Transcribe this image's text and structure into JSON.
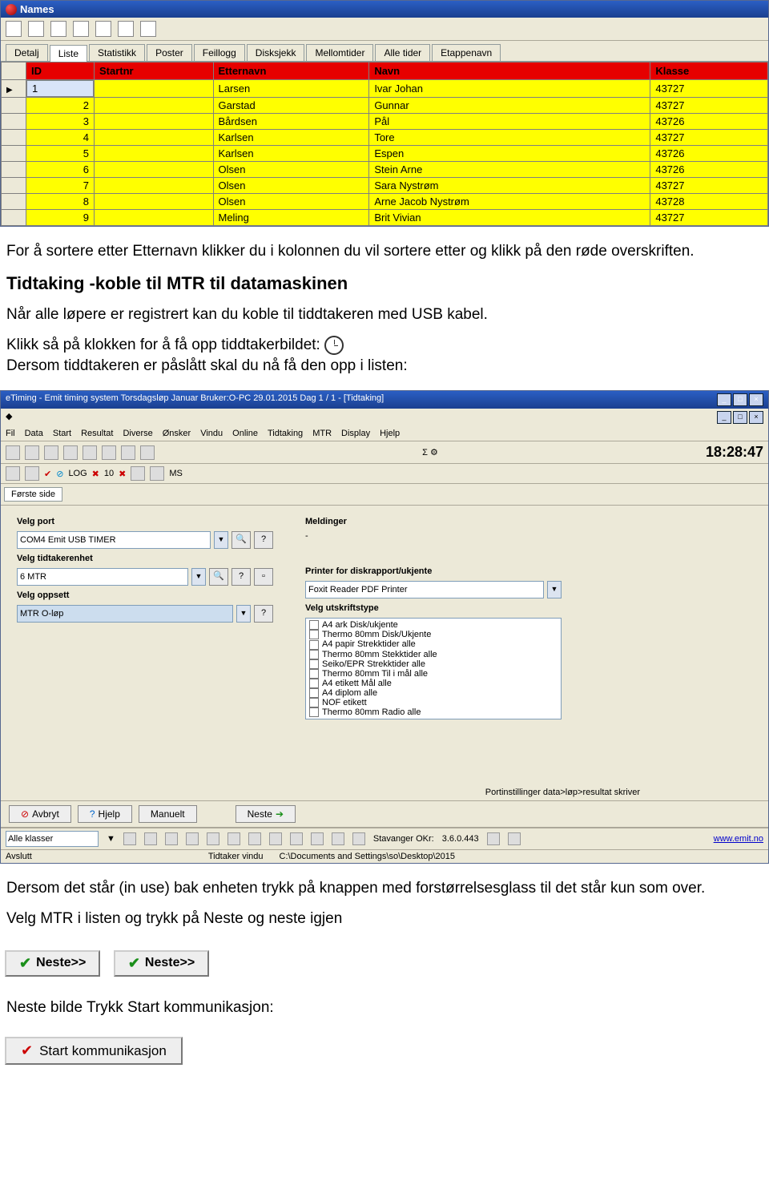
{
  "names_window": {
    "title": "Names",
    "tabs": [
      "Detalj",
      "Liste",
      "Statistikk",
      "Poster",
      "Feillogg",
      "Disksjekk",
      "Mellomtider",
      "Alle tider",
      "Etappenavn"
    ],
    "active_tab": "Liste",
    "columns": [
      "ID",
      "Startnr",
      "Etternavn",
      "Navn",
      "Klasse"
    ],
    "rows": [
      {
        "id": "1",
        "startnr": "",
        "etternavn": "Larsen",
        "navn": "Ivar Johan",
        "klasse": "43727",
        "current": true
      },
      {
        "id": "2",
        "startnr": "",
        "etternavn": "Garstad",
        "navn": "Gunnar",
        "klasse": "43727"
      },
      {
        "id": "3",
        "startnr": "",
        "etternavn": "Bårdsen",
        "navn": "Pål",
        "klasse": "43726"
      },
      {
        "id": "4",
        "startnr": "",
        "etternavn": "Karlsen",
        "navn": "Tore",
        "klasse": "43727"
      },
      {
        "id": "5",
        "startnr": "",
        "etternavn": "Karlsen",
        "navn": "Espen",
        "klasse": "43726"
      },
      {
        "id": "6",
        "startnr": "",
        "etternavn": "Olsen",
        "navn": "Stein Arne",
        "klasse": "43726"
      },
      {
        "id": "7",
        "startnr": "",
        "etternavn": "Olsen",
        "navn": "Sara Nystrøm",
        "klasse": "43727"
      },
      {
        "id": "8",
        "startnr": "",
        "etternavn": "Olsen",
        "navn": "Arne Jacob Nystrøm",
        "klasse": "43728"
      },
      {
        "id": "9",
        "startnr": "",
        "etternavn": "Meling",
        "navn": "Brit Vivian",
        "klasse": "43727"
      }
    ]
  },
  "text": {
    "p1": "For å sortere etter Etternavn klikker du i kolonnen du vil sortere etter og klikk på den røde overskriften.",
    "h1": "Tidtaking -koble til MTR til datamaskinen",
    "p2": "Når alle løpere er registrert kan du koble til tiddtakeren med USB kabel.",
    "p3a": "Klikk så på klokken for å få opp tiddtakerbildet:",
    "p3b": "Dersom tiddtakeren er påslått skal du nå få den opp i listen:",
    "p4": "Dersom det står (in use) bak enheten trykk på knappen med forstørrelsesglass til det står kun som over.",
    "p5": "Velg MTR i listen og trykk på Neste og neste igjen",
    "p6": "Neste bilde Trykk Start kommunikasjon:"
  },
  "app2": {
    "title": "eTiming - Emit timing system  Torsdagsløp Januar  Bruker:O-PC  29.01.2015  Dag 1 / 1 - [Tidtaking]",
    "menus": [
      "Fil",
      "Data",
      "Start",
      "Resultat",
      "Diverse",
      "Ønsker",
      "Vindu",
      "Online",
      "Tidtaking",
      "MTR",
      "Display",
      "Hjelp"
    ],
    "time": "18:28:47",
    "toolbar_text": [
      "LOG",
      "10",
      "MS"
    ],
    "side_tab": "Første side",
    "left": {
      "port_label": "Velg port",
      "port_value": "COM4 Emit USB TIMER",
      "enhet_label": "Velg tidtakerenhet",
      "enhet_value": "6 MTR",
      "oppsett_label": "Velg oppsett",
      "oppsett_value": "MTR O-løp"
    },
    "right": {
      "meldinger_label": "Meldinger",
      "meldinger_value": "-",
      "printer_label": "Printer for diskrapport/ukjente",
      "printer_value": "Foxit Reader PDF Printer",
      "utskrift_label": "Velg utskriftstype",
      "utskrift_items": [
        "A4 ark Disk/ukjente",
        "Thermo 80mm Disk/Ukjente",
        "A4 papir Strekktider alle",
        "Thermo 80mm Stekktider alle",
        "Seiko/EPR Strekktider alle",
        "Thermo 80mm Til i mål alle",
        "A4 etikett Mål alle",
        "A4 diplom alle",
        "NOF etikett",
        "Thermo 80mm Radio alle"
      ]
    },
    "foot_hint": "Portinstillinger data>løp>resultat skriver",
    "buttons": {
      "avbryt": "Avbryt",
      "hjelp": "Hjelp",
      "manuelt": "Manuelt",
      "neste": "Neste"
    },
    "status": {
      "klasser": "Alle klasser",
      "tidtaker": "Tidtaker vindu",
      "path": "C:\\Documents and Settings\\so\\Desktop\\2015",
      "okr": "Stavanger OKr:",
      "ver": "3.6.0.443",
      "link": "www.emit.no",
      "avslutt": "Avslutt"
    }
  },
  "neste_btn": "Neste>>",
  "start_btn": "Start kommunikasjon"
}
